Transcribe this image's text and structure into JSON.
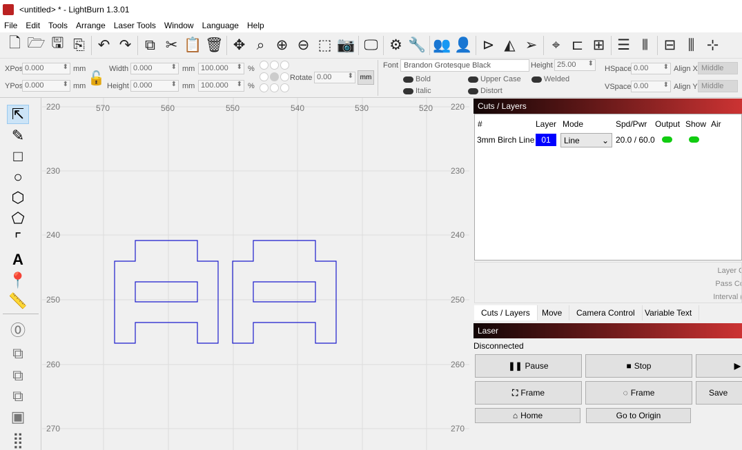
{
  "window": {
    "title": "<untitled> * - LightBurn 1.3.01"
  },
  "menu": [
    "File",
    "Edit",
    "Tools",
    "Arrange",
    "Laser Tools",
    "Window",
    "Language",
    "Help"
  ],
  "toolbar_icons": [
    "new-file-icon",
    "open-folder-icon",
    "save-icon",
    "save-as-icon",
    "undo-icon",
    "redo-icon",
    "copy-icon",
    "cut-icon",
    "paste-icon",
    "delete-icon",
    "move-icon",
    "zoom-fit-icon",
    "zoom-in-icon",
    "zoom-out-icon",
    "select-frame-icon",
    "camera-icon",
    "monitor-icon",
    "settings-icon",
    "tools-icon",
    "group-icon",
    "user-icon",
    "mirror-h-icon",
    "mirror-v-icon",
    "send-icon",
    "target-icon",
    "align-left-icon",
    "align-center-icon",
    "align-top-icon",
    "align-middle-icon",
    "distribute-h-icon",
    "distribute-v-icon",
    "distribute-icon"
  ],
  "props": {
    "xpos_label": "XPos",
    "xpos": "0.000",
    "ypos_label": "YPos",
    "ypos": "0.000",
    "unit": "mm",
    "width_label": "Width",
    "width": "0.000",
    "height_label": "Height",
    "height": "0.000",
    "scale_w": "100.000",
    "scale_h": "100.000",
    "pct": "%",
    "rotate_label": "Rotate",
    "rotate": "0.00",
    "mm_button": "mm"
  },
  "text_props": {
    "font_label": "Font",
    "font": "Brandon Grotesque Black",
    "height_label": "Height",
    "height": "25.00",
    "bold": "Bold",
    "italic": "Italic",
    "upper_case": "Upper Case",
    "distort": "Distort",
    "welded": "Welded",
    "hspace_label": "HSpace",
    "hspace": "0.00",
    "vspace_label": "VSpace",
    "vspace": "0.00",
    "alignx_label": "Align X",
    "alignx": "Middle",
    "aligny_label": "Align Y",
    "aligny": "Middle"
  },
  "tools": [
    "select-icon",
    "pen-icon",
    "rectangle-icon",
    "ellipse-icon",
    "polygon-icon",
    "pentagon-icon",
    "frame-icon",
    "text-icon",
    "pin-icon",
    "ruler-icon",
    "offset-icon",
    "boolean-union-icon",
    "boolean-subtract-icon",
    "boolean-intersect-icon",
    "weld-icon",
    "grid-array-icon"
  ],
  "ruler": {
    "x": [
      "570",
      "560",
      "550",
      "540",
      "530",
      "520"
    ],
    "y": [
      "220",
      "230",
      "240",
      "250",
      "260",
      "270"
    ]
  },
  "cuts": {
    "title": "Cuts / Layers",
    "headers": [
      "#",
      "Layer",
      "Mode",
      "Spd/Pwr",
      "Output",
      "Show",
      "Air"
    ],
    "rows": [
      {
        "name": "3mm Birch Line",
        "layer": "01",
        "mode": "Line",
        "spdpwr": "20.0 / 60.0",
        "output": true,
        "show": true
      }
    ],
    "layer_color": "#0000ff",
    "labels": [
      "Layer C",
      "Pass Co",
      "Interval ("
    ]
  },
  "tabs": [
    "Cuts / Layers",
    "Move",
    "Camera Control",
    "Variable Text"
  ],
  "laser": {
    "title": "Laser",
    "status": "Disconnected",
    "buttons": {
      "pause": "Pause",
      "stop": "Stop",
      "start": "",
      "frame1": "Frame",
      "frame2": "Frame",
      "save": "Save",
      "home": "Home",
      "origin": "Go to Origin"
    }
  }
}
